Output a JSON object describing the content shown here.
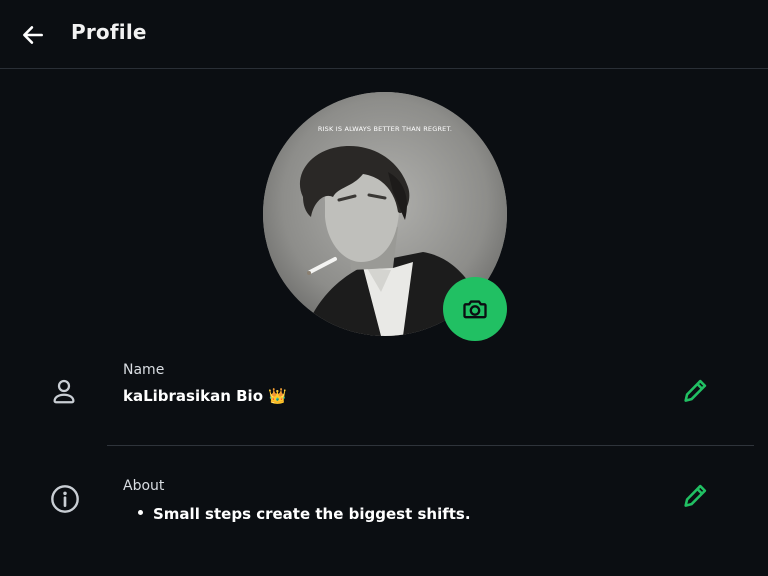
{
  "header": {
    "title": "Profile",
    "back_icon": "arrow-left-icon"
  },
  "avatar": {
    "caption": "RISK IS ALWAYS BETTER THAN REGRET.",
    "camera_icon": "camera-icon"
  },
  "name_row": {
    "icon": "person-icon",
    "label": "Name",
    "value": "kaLibrasikan Bio 👑",
    "edit_icon": "pencil-icon"
  },
  "about_row": {
    "icon": "info-icon",
    "label": "About",
    "value": "Small steps create the biggest shifts.",
    "edit_icon": "pencil-icon"
  },
  "colors": {
    "background": "#0b0e12",
    "accent": "#21c063",
    "divider": "#2f343b",
    "icon_gray": "#c9ced4"
  }
}
